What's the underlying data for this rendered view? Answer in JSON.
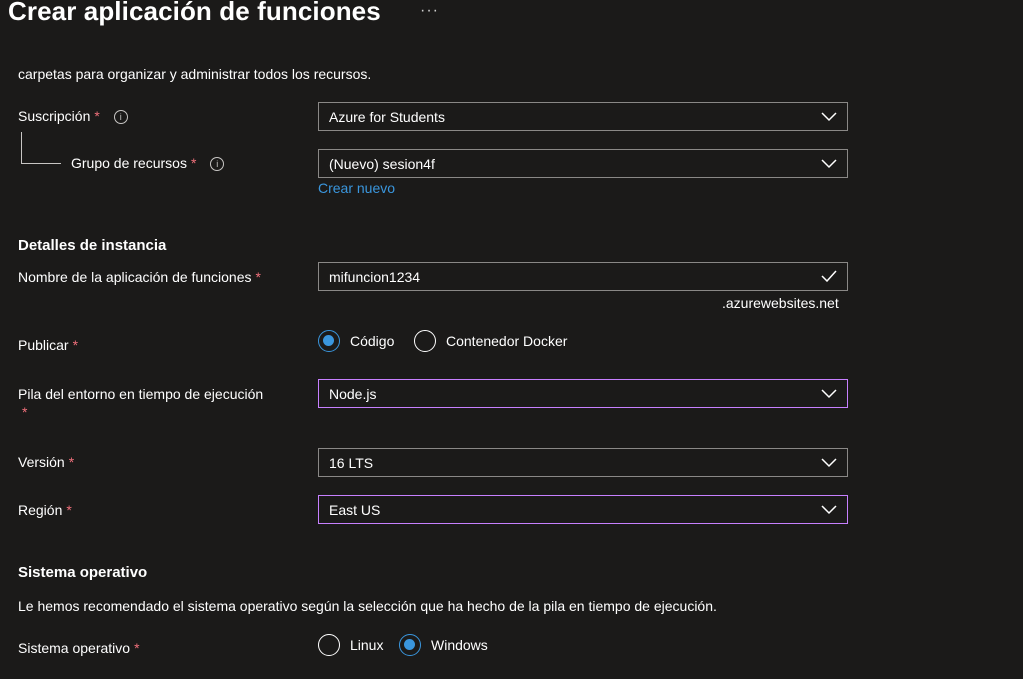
{
  "header": {
    "title": "Crear aplicación de funciones",
    "more": "···"
  },
  "intro": "carpetas para organizar y administrar todos los recursos.",
  "subscription": {
    "label": "Suscripción",
    "required": "*",
    "info": "i",
    "value": "Azure for Students"
  },
  "resource_group": {
    "label": "Grupo de recursos",
    "required": "*",
    "info": "i",
    "value": "(Nuevo) sesion4f",
    "create_new": "Crear nuevo"
  },
  "instance_details": {
    "heading": "Detalles de instancia",
    "app_name": {
      "label": "Nombre de la aplicación de funciones",
      "required": "*",
      "value": "mifuncion1234",
      "suffix": ".azurewebsites.net"
    },
    "publish": {
      "label": "Publicar",
      "required": "*",
      "options": [
        "Código",
        "Contenedor Docker"
      ],
      "selected": "Código"
    },
    "runtime_stack": {
      "label": "Pila del entorno en tiempo de ejecución",
      "required": "*",
      "value": "Node.js"
    },
    "version": {
      "label": "Versión",
      "required": "*",
      "value": "16 LTS"
    },
    "region": {
      "label": "Región",
      "required": "*",
      "value": "East US"
    }
  },
  "operating_system": {
    "heading": "Sistema operativo",
    "description": "Le hemos recomendado el sistema operativo según la selección que ha hecho de la pila en tiempo de ejecución.",
    "label": "Sistema operativo",
    "required": "*",
    "options": [
      "Linux",
      "Windows"
    ],
    "selected": "Windows"
  },
  "colors": {
    "background": "#1b1a19",
    "accent": "#3a96dd",
    "required": "#f1707b",
    "focus_border": "#c780ff",
    "border": "#8a8886"
  }
}
